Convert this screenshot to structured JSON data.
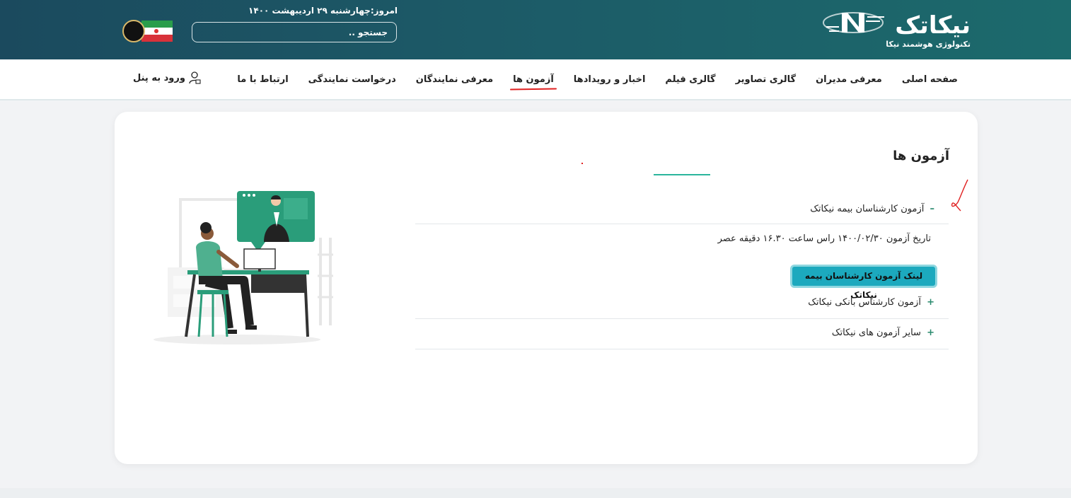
{
  "header": {
    "logo_text": "نیکاتک",
    "logo_subtitle": "تکنولوژی هوشمند نیکا",
    "date_text": "امروز:چهارشنبه ۲۹ اردیبهشت ۱۴۰۰",
    "search_placeholder": "جستجو .."
  },
  "nav": {
    "items": [
      {
        "label": "صفحه اصلی"
      },
      {
        "label": "معرفی مدیران"
      },
      {
        "label": "گالری تصاویر"
      },
      {
        "label": "گالری فیلم"
      },
      {
        "label": "اخبار و رویدادها"
      },
      {
        "label": "آزمون ها",
        "active": true
      },
      {
        "label": "معرفی نمایندگان"
      },
      {
        "label": "درخواست نمایندگی"
      },
      {
        "label": "ارتباط با ما"
      }
    ],
    "login_label": "ورود به پنل"
  },
  "main": {
    "title": "آزمون ها",
    "accordion": [
      {
        "sign": "–",
        "title": "آزمون کارشناسان بیمه نیکاتک",
        "expanded": true,
        "details": "تاریخ آزمون ۱۴۰۰/۰۲/۳۰ راس ساعت ۱۶.۳۰ دقیقه عصر",
        "button_label": "لینک آزمون کارشناسان بیمه نیکاتک"
      },
      {
        "sign": "+",
        "title": "آزمون کارشناس بانکی نیکاتک",
        "expanded": false
      },
      {
        "sign": "+",
        "title": "سایر آزمون های نیکاتک",
        "expanded": false
      }
    ]
  },
  "colors": {
    "header_start": "#1b4a5e",
    "header_end": "#1c6a6c",
    "accent": "#2bb59c",
    "button": "#1ca9be",
    "active_underline": "#e02020"
  }
}
